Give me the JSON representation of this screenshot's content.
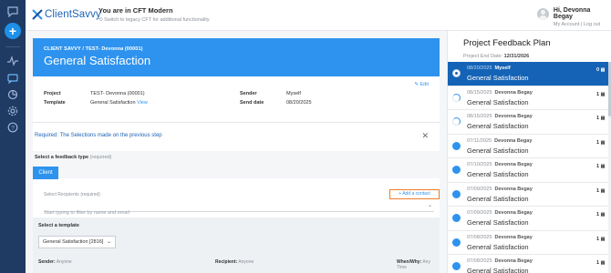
{
  "header": {
    "brand": "ClientSavvy",
    "env_title": "You are in CFT Modern",
    "env_link": "Switch to legacy CFT for additional functionality",
    "user_name": "Hi, Devonna Begay",
    "account_link": "My Account",
    "logout_link": "Log out",
    "separator": "|"
  },
  "sidebar": {
    "icons": [
      "chat-icon",
      "add-icon",
      "activity-icon",
      "feedback-icon",
      "pie-chart-icon",
      "settings-icon",
      "help-icon"
    ],
    "accent_color": "#1e90e8",
    "background_color": "#1f3a63"
  },
  "banner": {
    "breadcrumb": "CLIENT SAVVY / TEST- Devonna (00001)",
    "title": "General Satisfaction",
    "color": "#2e93ee"
  },
  "edit_label": "Edit",
  "details": {
    "project_label": "Project",
    "project_value": "TEST- Devonna (00001)",
    "template_label": "Template",
    "template_value": "General Satisfaction",
    "template_link": "View",
    "sender_label": "Sender",
    "sender_value": "Myself",
    "send_date_label": "Send date",
    "send_date_value": "08/20/2025"
  },
  "required_msg": "Required: The Selections made on the previous step",
  "feedback_type": {
    "label": "Select a feedback type",
    "hint": "(required)",
    "button": "Client"
  },
  "recipients": {
    "label": "Select Recipients",
    "hint": "(required)",
    "add_contact": "+ Add a contact",
    "placeholder": "Start typing to filter by name and email"
  },
  "template_section": {
    "label": "Select a template",
    "selected": "General Satisfaction [2816]",
    "sender_label": "Sender:",
    "sender_value": "Anyone",
    "recipient_label": "Recipient:",
    "recipient_value": "Anyone",
    "when_label": "When/Why:",
    "when_value": "Any Time"
  },
  "plan": {
    "title": "Project Feedback Plan",
    "end_date_label": "Project End Date:",
    "end_date": "12/31/2026",
    "items": [
      {
        "date": "08/20/2025",
        "who": "Myself",
        "name": "General Satisfaction",
        "count": "0",
        "state": "active"
      },
      {
        "date": "08/15/2025",
        "who": "Devonna Begay",
        "name": "General Satisfaction",
        "count": "1",
        "state": "part"
      },
      {
        "date": "08/15/2025",
        "who": "Devonna Begay",
        "name": "General Satisfaction",
        "count": "1",
        "state": "part"
      },
      {
        "date": "07/11/2025",
        "who": "Devonna Begay",
        "name": "General Satisfaction",
        "count": "1",
        "state": "done"
      },
      {
        "date": "07/10/2025",
        "who": "Devonna Begay",
        "name": "General Satisfaction",
        "count": "1",
        "state": "done"
      },
      {
        "date": "07/09/2025",
        "who": "Devonna Begay",
        "name": "General Satisfaction",
        "count": "1",
        "state": "done"
      },
      {
        "date": "07/09/2025",
        "who": "Devonna Begay",
        "name": "General Satisfaction",
        "count": "1",
        "state": "done"
      },
      {
        "date": "07/08/2025",
        "who": "Devonna Begay",
        "name": "General Satisfaction",
        "count": "1",
        "state": "done"
      },
      {
        "date": "07/08/2025",
        "who": "Devonna Begay",
        "name": "General Satisfaction",
        "count": "1",
        "state": "done"
      }
    ]
  }
}
